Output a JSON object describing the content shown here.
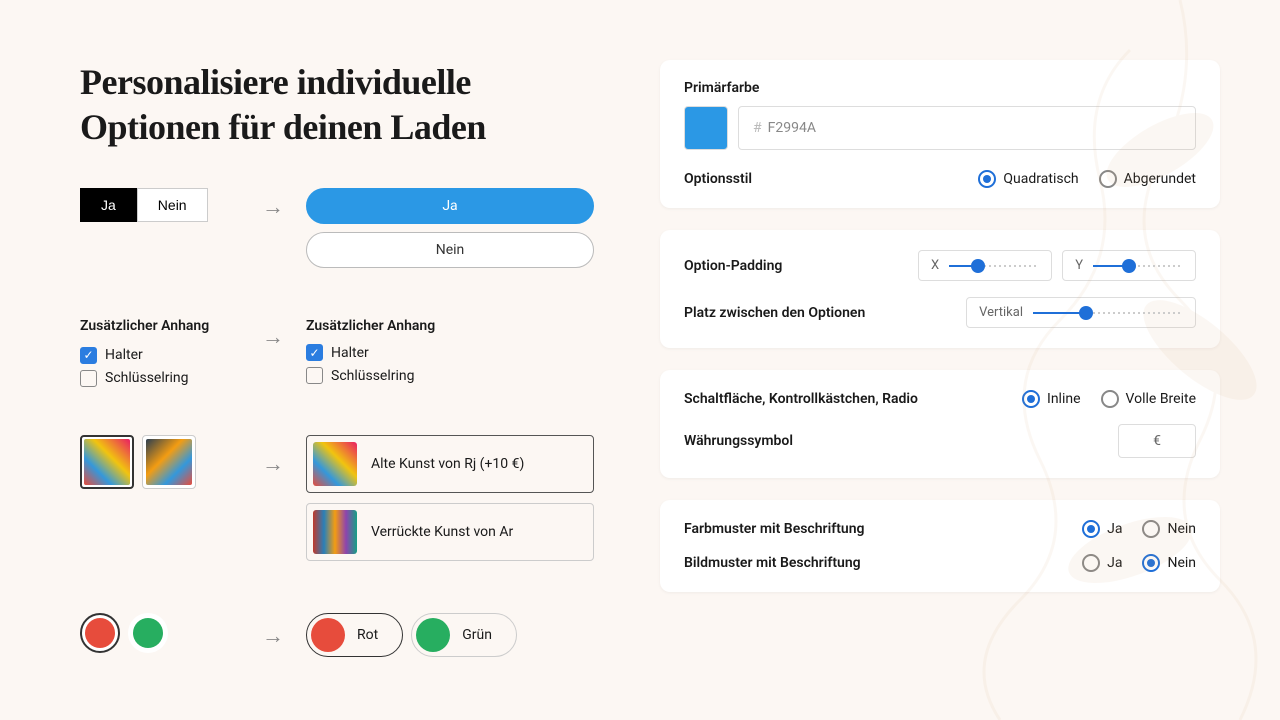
{
  "title": "Personalisiere individuelle Optionen für deinen Laden",
  "demo": {
    "buttons": {
      "yes": "Ja",
      "no": "Nein"
    },
    "attach": {
      "label": "Zusätzlicher Anhang",
      "opt1": "Halter",
      "opt2": "Schlüsselring"
    },
    "images": {
      "opt1": "Alte Kunst von Rj (+10 €)",
      "opt2": "Verrückte Kunst von Ar"
    },
    "swatches": {
      "red": "Rot",
      "green": "Grün"
    }
  },
  "settings": {
    "primaryColor": {
      "label": "Primärfarbe",
      "hex": "F2994A"
    },
    "optionStyle": {
      "label": "Optionsstil",
      "square": "Quadratisch",
      "rounded": "Abgerundet"
    },
    "padding": {
      "label": "Option-Padding",
      "x": "X",
      "y": "Y"
    },
    "spacing": {
      "label": "Platz zwischen den Optionen",
      "vertical": "Vertikal"
    },
    "layout": {
      "label": "Schaltfläche, Kontrollkästchen, Radio",
      "inline": "Inline",
      "full": "Volle Breite"
    },
    "currency": {
      "label": "Währungssymbol",
      "value": "€"
    },
    "colorSwatch": {
      "label": "Farbmuster mit Beschriftung",
      "yes": "Ja",
      "no": "Nein"
    },
    "imageSwatch": {
      "label": "Bildmuster mit Beschriftung",
      "yes": "Ja",
      "no": "Nein"
    }
  }
}
